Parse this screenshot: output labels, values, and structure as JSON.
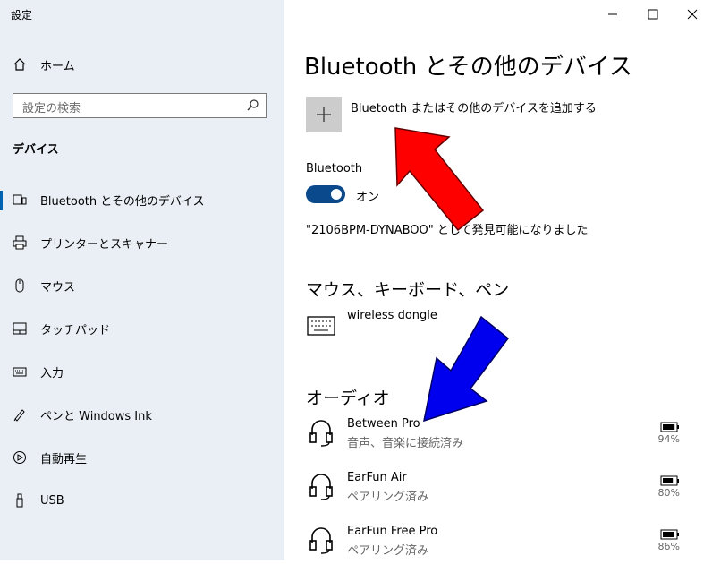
{
  "window": {
    "title": "設定",
    "minimize_label": "—",
    "maximize_label": "☐",
    "close_label": "✕"
  },
  "sidebar": {
    "home_label": "ホーム",
    "search_placeholder": "設定の検索",
    "section_title": "デバイス",
    "items": [
      {
        "label": "Bluetooth とその他のデバイス",
        "icon": "bluetooth-devices-icon",
        "active": true
      },
      {
        "label": "プリンターとスキャナー",
        "icon": "printer-icon"
      },
      {
        "label": "マウス",
        "icon": "mouse-icon"
      },
      {
        "label": "タッチパッド",
        "icon": "touchpad-icon"
      },
      {
        "label": "入力",
        "icon": "keyboard-icon"
      },
      {
        "label": "ペンと Windows Ink",
        "icon": "pen-icon"
      },
      {
        "label": "自動再生",
        "icon": "autoplay-icon"
      },
      {
        "label": "USB",
        "icon": "usb-icon"
      }
    ]
  },
  "main": {
    "title": "Bluetooth とその他のデバイス",
    "add_device_label": "Bluetooth またはその他のデバイスを追加する",
    "bluetooth": {
      "heading": "Bluetooth",
      "toggle_state": "オン",
      "discoverable_text": "\"2106BPM-DYNABOO\" として発見可能になりました"
    },
    "mouse_section": {
      "heading": "マウス、キーボード、ペン",
      "devices": [
        {
          "name": "wireless dongle",
          "icon": "keyboard-icon"
        }
      ]
    },
    "audio_section": {
      "heading": "オーディオ",
      "devices": [
        {
          "name": "Between Pro",
          "status": "音声、音楽に接続済み",
          "battery": "94%",
          "battery_level": 0.94
        },
        {
          "name": "EarFun Air",
          "status": "ペアリング済み",
          "battery": "80%",
          "battery_level": 0.8
        },
        {
          "name": "EarFun Free Pro",
          "status": "ペアリング済み",
          "battery": "86%",
          "battery_level": 0.86
        }
      ]
    }
  },
  "colors": {
    "sidebar_bg": "#e9eff5",
    "accent": "#0063b1",
    "toggle_on": "#0a4a8c",
    "arrow_red": "#ff0000",
    "arrow_blue": "#0000ee"
  }
}
